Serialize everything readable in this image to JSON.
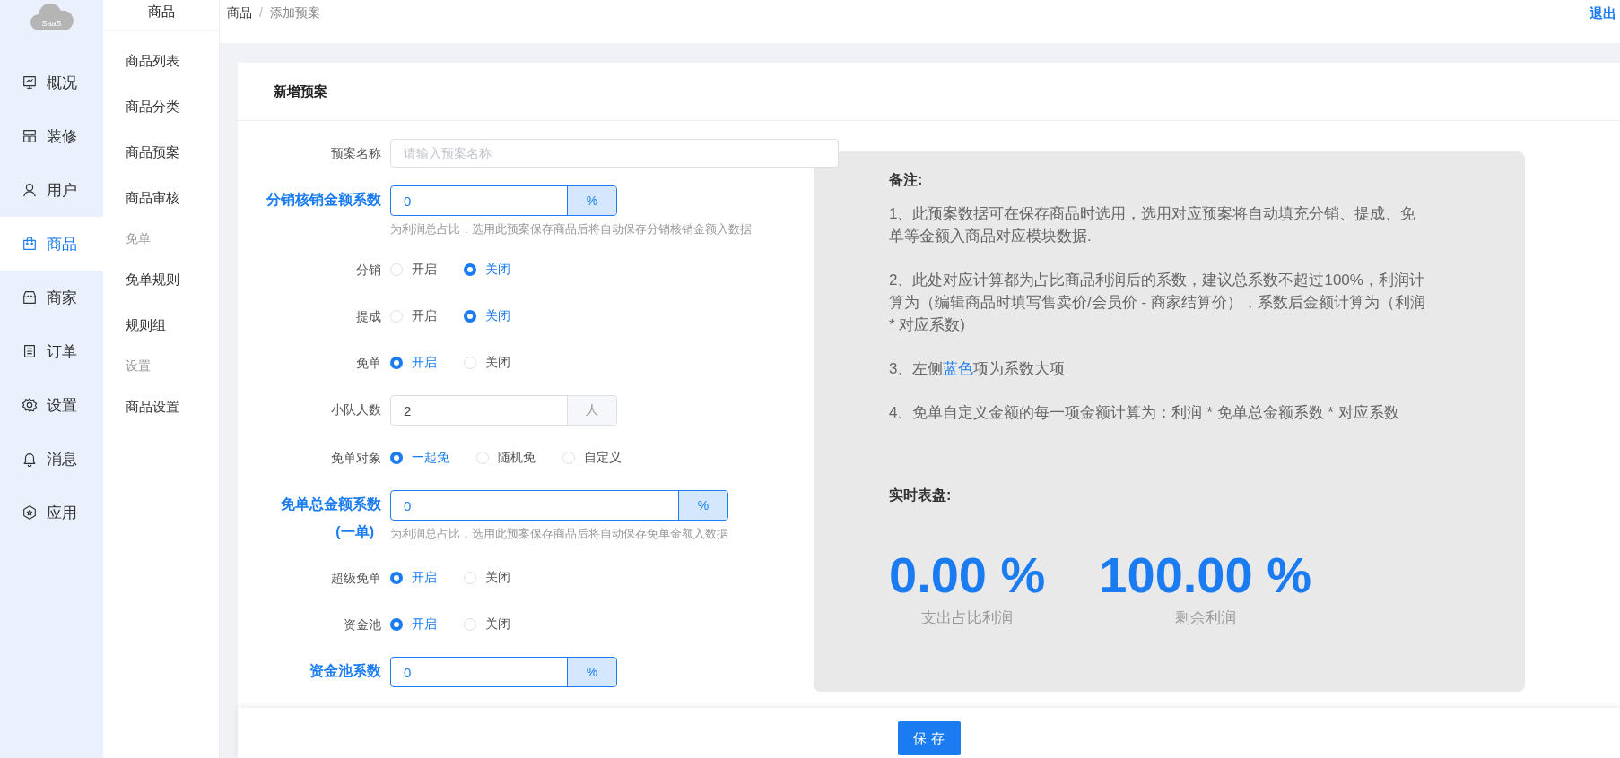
{
  "logo": {
    "text": "SaaS"
  },
  "nav": [
    {
      "label": "概况",
      "selected": false
    },
    {
      "label": "装修",
      "selected": false
    },
    {
      "label": "用户",
      "selected": false
    },
    {
      "label": "商品",
      "selected": true
    },
    {
      "label": "商家",
      "selected": false
    },
    {
      "label": "订单",
      "selected": false
    },
    {
      "label": "设置",
      "selected": false
    },
    {
      "label": "消息",
      "selected": false
    },
    {
      "label": "应用",
      "selected": false
    }
  ],
  "subnav": {
    "title": "商品",
    "items": [
      {
        "kind": "link",
        "label": "商品列表"
      },
      {
        "kind": "link",
        "label": "商品分类"
      },
      {
        "kind": "link",
        "label": "商品预案"
      },
      {
        "kind": "link",
        "label": "商品审核"
      },
      {
        "kind": "group",
        "label": "免单"
      },
      {
        "kind": "link",
        "label": "免单规则"
      },
      {
        "kind": "link",
        "label": "规则组"
      },
      {
        "kind": "group",
        "label": "设置"
      },
      {
        "kind": "link",
        "label": "商品设置"
      }
    ]
  },
  "breadcrumb": [
    "商品",
    "/",
    "添加预案"
  ],
  "logout": "退出",
  "card_title": "新增预案",
  "form": [
    {
      "kind": "text",
      "label": "预案名称",
      "placeholder": "请输入预案名称"
    },
    {
      "kind": "coefficient",
      "label": "分销核销金额系数",
      "value": "0",
      "unit": "%",
      "hint": "为利润总占比，选用此预案保存商品后将自动保存分销核销金额入数据"
    },
    {
      "kind": "radio",
      "label": "分销",
      "options": [
        {
          "label": "开启",
          "selected": false
        },
        {
          "label": "关闭",
          "selected": true
        }
      ]
    },
    {
      "kind": "radio",
      "label": "提成",
      "options": [
        {
          "label": "开启",
          "selected": false
        },
        {
          "label": "关闭",
          "selected": true
        }
      ]
    },
    {
      "kind": "radio",
      "label": "免单",
      "options": [
        {
          "label": "开启",
          "selected": true
        },
        {
          "label": "关闭",
          "selected": false
        }
      ]
    },
    {
      "kind": "unit",
      "label": "小队人数",
      "value": "2",
      "unit": "人"
    },
    {
      "kind": "radio",
      "label": "免单对象",
      "options": [
        {
          "label": "一起免",
          "selected": true
        },
        {
          "label": "随机免",
          "selected": false
        },
        {
          "label": "自定义",
          "selected": false
        }
      ]
    },
    {
      "kind": "coefficient-wide",
      "label": "免单总金额系数",
      "label_line2": "(一单)",
      "value": "0",
      "unit": "%",
      "hint": "为利润总占比，选用此预案保存商品后将自动保存免单金额入数据"
    },
    {
      "kind": "radio",
      "label": "超级免单",
      "options": [
        {
          "label": "开启",
          "selected": true
        },
        {
          "label": "关闭",
          "selected": false
        }
      ]
    },
    {
      "kind": "radio",
      "label": "资金池",
      "options": [
        {
          "label": "开启",
          "selected": true
        },
        {
          "label": "关闭",
          "selected": false
        }
      ]
    },
    {
      "kind": "coefficient",
      "label": "资金池系数",
      "value": "0",
      "unit": "%"
    }
  ],
  "notes": {
    "title": "备注:",
    "paragraphs": [
      [
        {
          "text": "1、此预案数据可在保存商品时选用，选用对应预案将自动填充分销、提成、免单等金额入商品对应模块数据."
        }
      ],
      [
        {
          "text": "2、此处对应计算都为占比商品利润后的系数，建议总系数不超过100%，利润计算为（编辑商品时填写售卖价/会员价 - 商家结算价），系数后金额计算为（利润 * 对应系数)"
        }
      ],
      [
        {
          "text": "3、左侧"
        },
        {
          "text": "蓝色",
          "highlight": true
        },
        {
          "text": "项为系数大项"
        }
      ],
      [
        {
          "text": "4、免单自定义金额的每一项金额计算为：利润 * 免单总金额系数 * 对应系数"
        }
      ]
    ]
  },
  "dashboard": {
    "title": "实时表盘:",
    "stats": [
      {
        "value": "0.00 %",
        "label": "支出占比利润"
      },
      {
        "value": "100.00 %",
        "label": "剩余利润"
      }
    ]
  },
  "save_button": "保 存"
}
